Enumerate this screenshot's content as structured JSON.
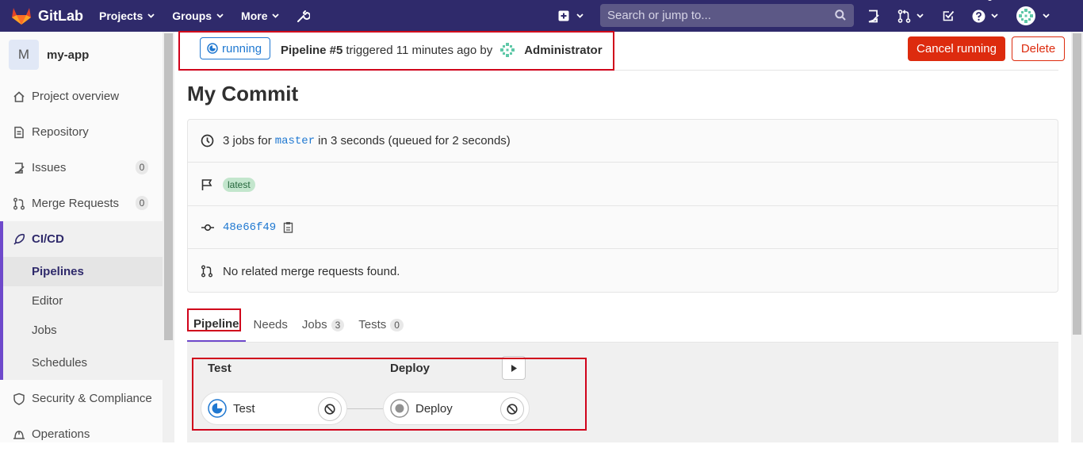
{
  "navbar": {
    "brand": "GitLab",
    "menu": [
      {
        "label": "Projects"
      },
      {
        "label": "Groups"
      },
      {
        "label": "More"
      }
    ],
    "search_placeholder": "Search or jump to..."
  },
  "sidebar": {
    "project_initial": "M",
    "project_name": "my-app",
    "items": [
      {
        "label": "Project overview",
        "icon": "home-icon"
      },
      {
        "label": "Repository",
        "icon": "doc-icon"
      },
      {
        "label": "Issues",
        "icon": "issues-icon",
        "badge": "0"
      },
      {
        "label": "Merge Requests",
        "icon": "merge-request-icon",
        "badge": "0"
      },
      {
        "label": "CI/CD",
        "icon": "rocket-icon"
      }
    ],
    "cicd_sub": [
      {
        "label": "Pipelines"
      },
      {
        "label": "Editor"
      },
      {
        "label": "Jobs"
      },
      {
        "label": "Schedules"
      }
    ],
    "more_items": [
      {
        "label": "Security & Compliance",
        "icon": "shield-icon"
      },
      {
        "label": "Operations",
        "icon": "operations-icon"
      }
    ]
  },
  "header": {
    "status": "running",
    "pipeline_label": "Pipeline #5",
    "triggered_text": "triggered 11 minutes ago by",
    "author": "Administrator",
    "cancel_label": "Cancel running",
    "delete_label": "Delete"
  },
  "commit": {
    "title": "My Commit",
    "jobs_prefix": "3 jobs for",
    "branch": "master",
    "jobs_suffix": "in 3 seconds (queued for 2 seconds)",
    "tag": "latest",
    "sha": "48e66f49",
    "mr_text": "No related merge requests found."
  },
  "tabs": [
    {
      "label": "Pipeline"
    },
    {
      "label": "Needs"
    },
    {
      "label": "Jobs",
      "count": "3"
    },
    {
      "label": "Tests",
      "count": "0"
    }
  ],
  "graph": {
    "stages": [
      {
        "title": "Test",
        "job": "Test",
        "status": "running"
      },
      {
        "title": "Deploy",
        "job": "Deploy",
        "status": "created"
      }
    ]
  },
  "colors": {
    "navbar": "#2f2a6b",
    "accent": "#6e49cb",
    "running": "#1f78d1",
    "danger": "#dd2b0e",
    "highlight": "#d0021b"
  }
}
